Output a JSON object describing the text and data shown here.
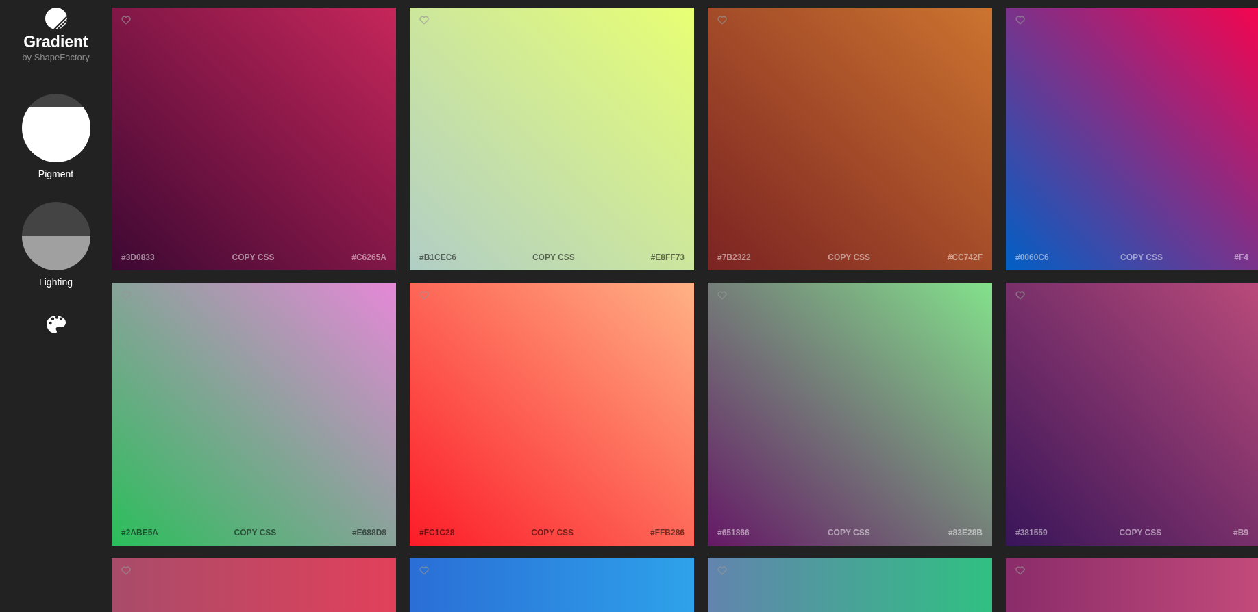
{
  "sidebar": {
    "logo": {
      "title": "Gradient",
      "subtitle": "by ShapeFactory"
    },
    "controls": [
      {
        "label": "Pigment",
        "kind": "pigment"
      },
      {
        "label": "Lighting",
        "kind": "lighting"
      }
    ]
  },
  "cards": [
    {
      "from": "#3D0833",
      "action": "COPY CSS",
      "to": "#C6265A"
    },
    {
      "from": "#B1CEC6",
      "action": "COPY CSS",
      "to": "#E8FF73"
    },
    {
      "from": "#7B2322",
      "action": "COPY CSS",
      "to": "#CC742F"
    },
    {
      "from": "#0060C6",
      "action": "COPY CSS",
      "to": "#F4",
      "end": {
        "color": "#f4054f"
      }
    },
    {
      "from": "#2ABE5A",
      "action": "COPY CSS",
      "to": "#E688D8"
    },
    {
      "from": "#FC1C28",
      "action": "COPY CSS",
      "to": "#FFB286"
    },
    {
      "from": "#651866",
      "action": "COPY CSS",
      "to": "#83E28B"
    },
    {
      "from": "#381559",
      "action": "COPY CSS",
      "to": "#B9",
      "end": {
        "color": "#b94a7a"
      }
    },
    {
      "stops": [
        {
          "color": "#a84c6a"
        },
        {
          "color": "#e2405a"
        }
      ]
    },
    {
      "stops": [
        {
          "color": "#2a6ed6"
        },
        {
          "color": "#2ea2ea"
        }
      ]
    },
    {
      "stops": [
        {
          "color": "#6284ae"
        },
        {
          "color": "#30c082"
        }
      ]
    },
    {
      "stops": [
        {
          "color": "#8a2c6a"
        },
        {
          "color": "#c24a7a"
        }
      ]
    }
  ]
}
